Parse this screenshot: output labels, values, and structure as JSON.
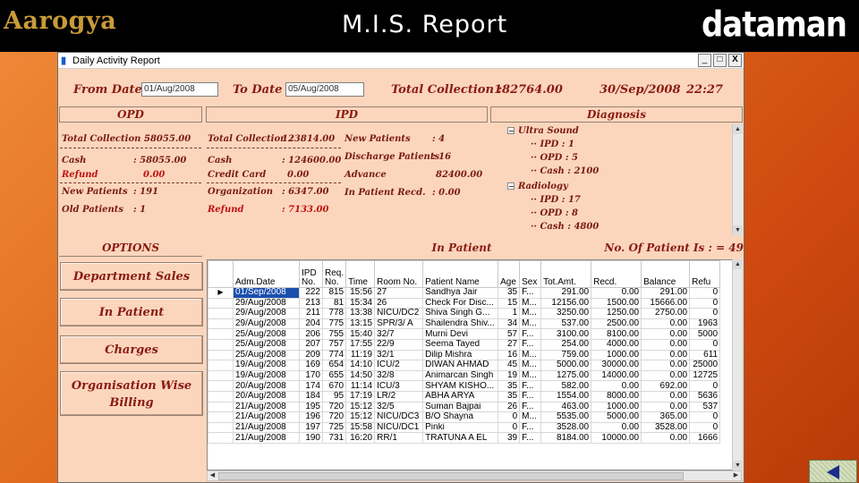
{
  "header": {
    "logo_left": "Aarogya",
    "title": "M.I.S. Report",
    "logo_right": "dataman"
  },
  "window": {
    "title": "Daily Activity Report",
    "controls": {
      "minimize": "_",
      "maximize": "□",
      "close": "X"
    }
  },
  "filters": {
    "from_date_label": "From Date",
    "from_date_value": "01/Aug/2008",
    "to_date_label": "To Date",
    "to_date_value": "05/Aug/2008",
    "total_collection_label": "Total Collection :",
    "total_collection_value": "182764.00",
    "current_date": "30/Sep/2008",
    "current_time": "22:27"
  },
  "opd": {
    "header": "OPD",
    "total_collection_label": "Total Collection :",
    "total_collection_value": "58055.00",
    "cash_label": "Cash",
    "cash_value": ": 58055.00",
    "refund_label": "Refund",
    "refund_value": "0.00",
    "new_patients_label": "New Patients",
    "new_patients_value": ": 191",
    "old_patients_label": "Old Patients",
    "old_patients_value": ": 1"
  },
  "ipd": {
    "header": "IPD",
    "total_collection_label": "Total Collection :",
    "total_collection_value": "123814.00",
    "cash_label": "Cash",
    "cash_value": ": 124600.00",
    "credit_card_label": "Credit Card",
    "credit_card_value": "0.00",
    "organization_label": "Organization",
    "organization_value": ": 6347.00",
    "refund_label": "Refund",
    "refund_value": ": 7133.00",
    "new_patients_label": "New Patients",
    "new_patients_value": ": 4",
    "discharge_label": "Discharge Patients",
    "discharge_value": ": 16",
    "advance_label": "Advance",
    "advance_value": "82400.00",
    "in_patient_recd_label": "In Patient Recd.",
    "in_patient_recd_value": ": 0.00"
  },
  "diagnosis": {
    "header": "Diagnosis",
    "tree": [
      {
        "text": "Ultra Sound",
        "level": 0,
        "expander": "−"
      },
      {
        "text": "IPD : 1",
        "level": 1
      },
      {
        "text": "OPD : 5",
        "level": 1
      },
      {
        "text": "Cash : 2100",
        "level": 1
      },
      {
        "text": "Radiology",
        "level": 0,
        "expander": "−"
      },
      {
        "text": "IPD : 17",
        "level": 1
      },
      {
        "text": "OPD : 8",
        "level": 1
      },
      {
        "text": "Cash : 4800",
        "level": 1
      }
    ]
  },
  "options": {
    "header": "OPTIONS",
    "buttons": [
      {
        "label": "Department Sales"
      },
      {
        "label": "In Patient"
      },
      {
        "label": "Charges"
      },
      {
        "label_line1": "Organisation Wise",
        "label_line2": "Billing"
      }
    ]
  },
  "inpatient": {
    "header": "In Patient",
    "count_label": "No. Of Patient Is : = 49",
    "columns": [
      "",
      "Adm.Date",
      "IPD No.",
      "Req. No.",
      "Time",
      "Room No.",
      "Patient Name",
      "Age",
      "Sex",
      "Tot.Amt.",
      "Recd.",
      "Balance",
      "Refu"
    ],
    "rows": [
      [
        "▶",
        "01/Sep/2008",
        "222",
        "815",
        "15:56",
        "27",
        "Sandhya Jair",
        "35",
        "F...",
        "291.00",
        "0.00",
        "291.00",
        "0"
      ],
      [
        "",
        "29/Aug/2008",
        "213",
        "81",
        "15:34",
        "26",
        "Check For Disc...",
        "15",
        "M...",
        "12156.00",
        "1500.00",
        "15666.00",
        "0"
      ],
      [
        "",
        "29/Aug/2008",
        "211",
        "778",
        "13:38",
        "NICU/DC2",
        "Shiva Singh G...",
        "1",
        "M...",
        "3250.00",
        "1250.00",
        "2750.00",
        "0"
      ],
      [
        "",
        "29/Aug/2008",
        "204",
        "775",
        "13:15",
        "SPR/3/ A",
        "Shailendra Shiv...",
        "34",
        "M...",
        "537.00",
        "2500.00",
        "0.00",
        "1963"
      ],
      [
        "",
        "25/Aug/2008",
        "206",
        "755",
        "15:40",
        "32/7",
        "Murni Devi",
        "57",
        "F...",
        "3100.00",
        "8100.00",
        "0.00",
        "5000"
      ],
      [
        "",
        "25/Aug/2008",
        "207",
        "757",
        "17:55",
        "22/9",
        "Seema Tayed",
        "27",
        "F...",
        "254.00",
        "4000.00",
        "0.00",
        "0"
      ],
      [
        "",
        "25/Aug/2008",
        "209",
        "774",
        "11:19",
        "32/1",
        "Dilip Mishra",
        "16",
        "M...",
        "759.00",
        "1000.00",
        "0.00",
        "611"
      ],
      [
        "",
        "19/Aug/2008",
        "169",
        "654",
        "14:10",
        "ICU/2",
        "DIWAN AHMAD",
        "45",
        "M...",
        "5000.00",
        "30000.00",
        "0.00",
        "25000"
      ],
      [
        "",
        "19/Aug/2008",
        "170",
        "655",
        "14:50",
        "32/8",
        "Animarcan Singh",
        "19",
        "M...",
        "1275.00",
        "14000.00",
        "0.00",
        "12725"
      ],
      [
        "",
        "20/Aug/2008",
        "174",
        "670",
        "11:14",
        "ICU/3",
        "SHYAM KISHO...",
        "35",
        "F...",
        "582.00",
        "0.00",
        "692.00",
        "0"
      ],
      [
        "",
        "20/Aug/2008",
        "184",
        "95",
        "17:19",
        "LR/2",
        "ABHA ARYA",
        "35",
        "F...",
        "1554.00",
        "8000.00",
        "0.00",
        "5636"
      ],
      [
        "",
        "21/Aug/2008",
        "195",
        "720",
        "15:12",
        "32/5",
        "Suman Bajpai",
        "26",
        "F...",
        "463.00",
        "1000.00",
        "0.00",
        "537"
      ],
      [
        "",
        "21/Aug/2008",
        "196",
        "720",
        "15:12",
        "NICU/DC3",
        "B/O Shayna",
        "0",
        "M...",
        "5535.00",
        "5000.00",
        "365.00",
        "0"
      ],
      [
        "",
        "21/Aug/2008",
        "197",
        "725",
        "15:58",
        "NICU/DC1",
        "Pinki",
        "0",
        "F...",
        "3528.00",
        "0.00",
        "3528.00",
        "0"
      ],
      [
        "",
        "21/Aug/2008",
        "190",
        "731",
        "16:20",
        "RR/1",
        "TRATUNA A EL",
        "39",
        "F...",
        "8184.00",
        "10000.00",
        "0.00",
        "1666"
      ]
    ]
  }
}
